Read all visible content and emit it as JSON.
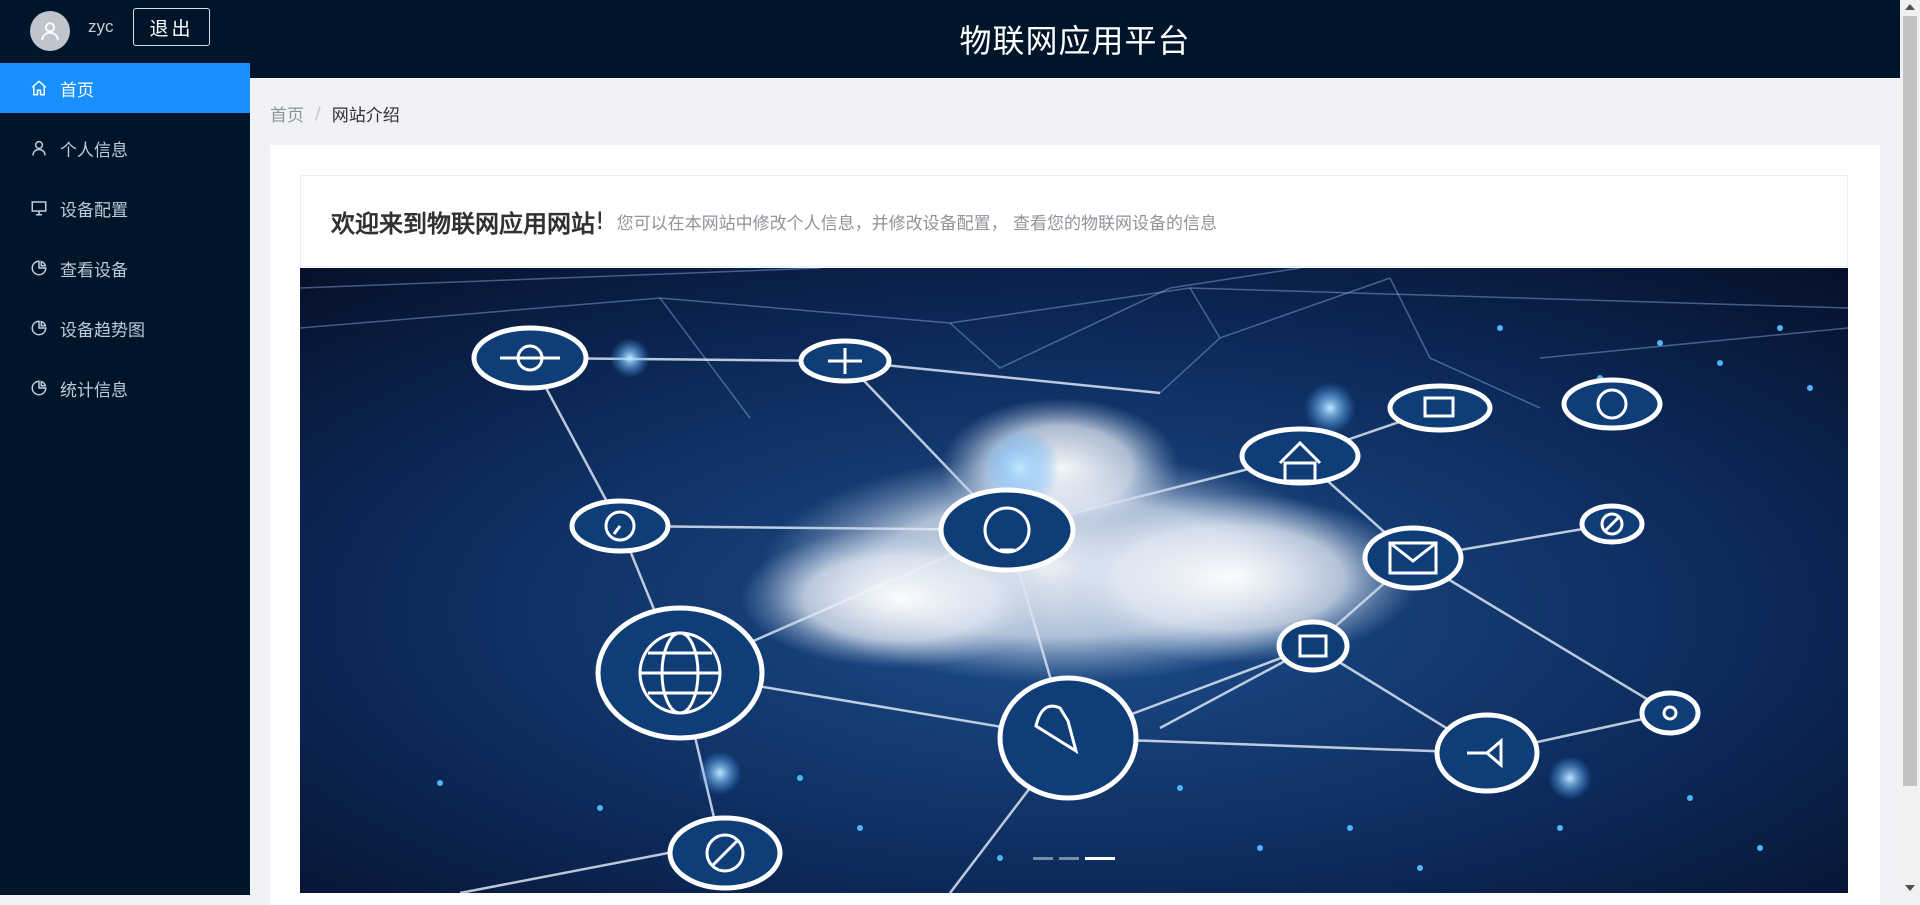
{
  "app": {
    "title": "物联网应用平台"
  },
  "user": {
    "name": "zyc",
    "logout_label": "退出"
  },
  "sidebar": {
    "items": [
      {
        "label": "首页",
        "icon": "home-icon",
        "active": true
      },
      {
        "label": "个人信息",
        "icon": "user-icon",
        "active": false
      },
      {
        "label": "设备配置",
        "icon": "monitor-icon",
        "active": false
      },
      {
        "label": "查看设备",
        "icon": "pie-chart-icon",
        "active": false
      },
      {
        "label": "设备趋势图",
        "icon": "pie-chart-icon",
        "active": false
      },
      {
        "label": "统计信息",
        "icon": "pie-chart-icon",
        "active": false
      }
    ]
  },
  "breadcrumb": {
    "home": "首页",
    "separator": "/",
    "current": "网站介绍"
  },
  "welcome": {
    "title": "欢迎来到物联网应用网站",
    "exclamation": "!",
    "description": "您可以在本网站中修改个人信息，并修改设备配置， 查看您的物联网设备的信息"
  },
  "carousel": {
    "slide_count": 3,
    "active_index": 2
  },
  "colors": {
    "sidebar_bg": "#001529",
    "accent": "#1890ff",
    "page_bg": "#f0f2f5"
  }
}
